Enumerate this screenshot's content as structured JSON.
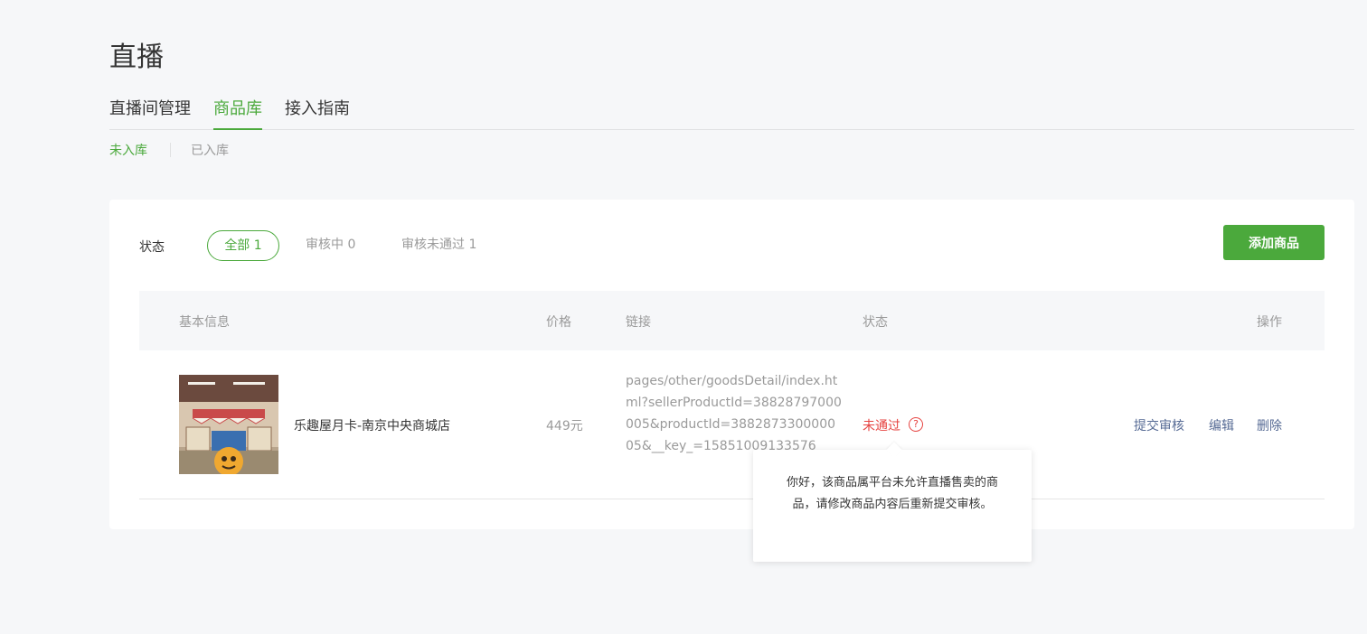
{
  "page": {
    "title": "直播"
  },
  "main_tabs": [
    {
      "label": "直播间管理"
    },
    {
      "label": "商品库"
    },
    {
      "label": "接入指南"
    }
  ],
  "sub_tabs": [
    {
      "label": "未入库"
    },
    {
      "label": "已入库"
    }
  ],
  "filter": {
    "label": "状态",
    "options": [
      {
        "label": "全部 1"
      },
      {
        "label": "审核中 0"
      },
      {
        "label": "审核未通过 1"
      }
    ]
  },
  "add_button": "添加商品",
  "table": {
    "headers": [
      "基本信息",
      "价格",
      "链接",
      "状态",
      "操作"
    ],
    "rows": [
      {
        "name": "乐趣屋月卡-南京中央商城店",
        "price": "449元",
        "link": "pages/other/goodsDetail/index.html?sellerProductId=38828797000005&productId=388287330000005&__key_=15851009133576",
        "status": "未通过",
        "actions": [
          "提交审核",
          "编辑",
          "删除"
        ]
      }
    ]
  },
  "tooltip": {
    "text": "你好，该商品属平台未允许直播售卖的商品，请修改商品内容后重新提交审核。"
  },
  "colors": {
    "accent": "#4ba93c",
    "error": "#e64340",
    "link": "#576b95"
  }
}
